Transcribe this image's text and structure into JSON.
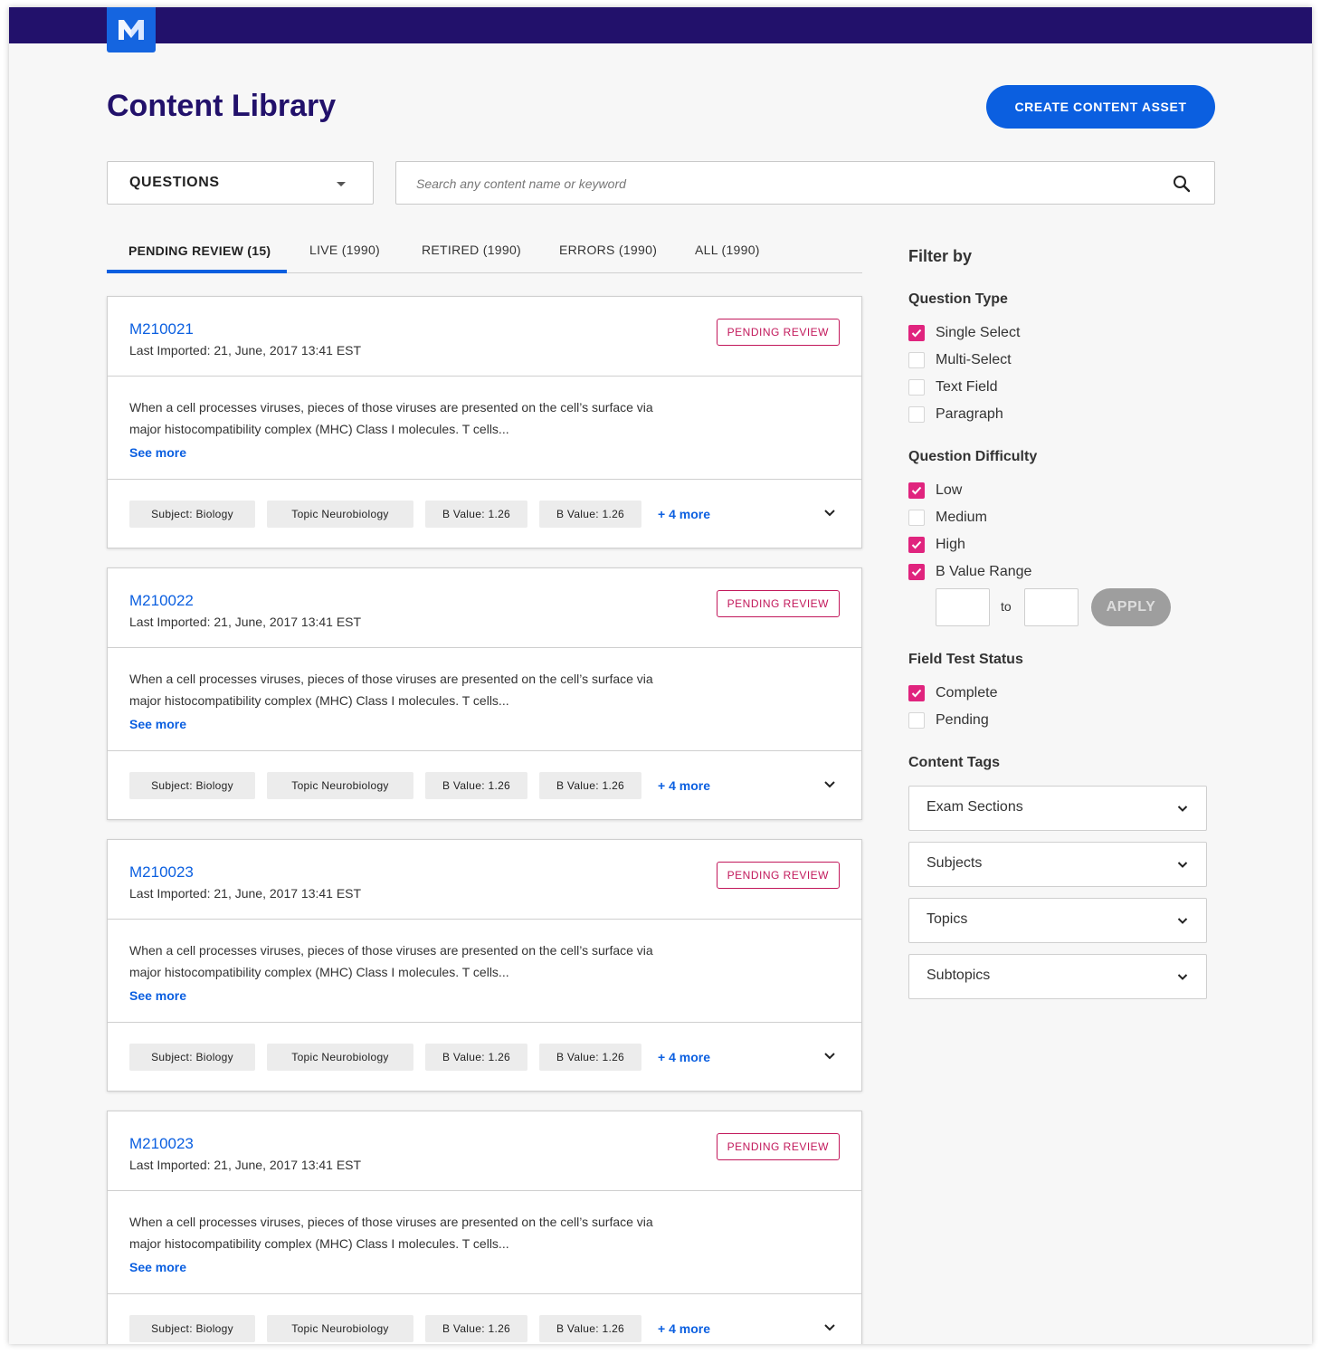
{
  "app": {
    "logo_letter": "M",
    "page_title": "Content Library",
    "create_button": "CREATE CONTENT ASSET"
  },
  "toolbar": {
    "type_select_value": "QUESTIONS",
    "search_placeholder": "Search any content name or keyword"
  },
  "tabs": [
    {
      "label": "PENDING REVIEW (15)",
      "active": true
    },
    {
      "label": "LIVE (1990)",
      "active": false
    },
    {
      "label": "RETIRED (1990)",
      "active": false
    },
    {
      "label": "ERRORS (1990)",
      "active": false
    },
    {
      "label": "ALL (1990)",
      "active": false
    }
  ],
  "cards": [
    {
      "id": "M210021",
      "imported": "Last Imported: 21, June, 2017 13:41 EST",
      "badge": "PENDING REVIEW",
      "desc_line1": "When a cell processes viruses, pieces of those viruses are presented on the cell’s surface via",
      "desc_line2": "major histocompatibility complex (MHC) Class I molecules. T cells...",
      "see_more": "See more",
      "tags": [
        "Subject: Biology",
        "Topic Neurobiology",
        "B Value: 1.26",
        "B Value: 1.26"
      ],
      "more": "+ 4 more"
    },
    {
      "id": "M210022",
      "imported": "Last Imported: 21, June, 2017 13:41 EST",
      "badge": "PENDING REVIEW",
      "desc_line1": "When a cell processes viruses, pieces of those viruses are presented on the cell’s surface via",
      "desc_line2": "major histocompatibility complex (MHC) Class I molecules. T cells...",
      "see_more": "See more",
      "tags": [
        "Subject: Biology",
        "Topic Neurobiology",
        "B Value: 1.26",
        "B Value: 1.26"
      ],
      "more": "+ 4 more"
    },
    {
      "id": "M210023",
      "imported": "Last Imported: 21, June, 2017 13:41 EST",
      "badge": "PENDING REVIEW",
      "desc_line1": "When a cell processes viruses, pieces of those viruses are presented on the cell’s surface via",
      "desc_line2": "major histocompatibility complex (MHC) Class I molecules. T cells...",
      "see_more": "See more",
      "tags": [
        "Subject: Biology",
        "Topic Neurobiology",
        "B Value: 1.26",
        "B Value: 1.26"
      ],
      "more": "+ 4 more"
    },
    {
      "id": "M210023",
      "imported": "Last Imported: 21, June, 2017 13:41 EST",
      "badge": "PENDING REVIEW",
      "desc_line1": "When a cell processes viruses, pieces of those viruses are presented on the cell’s surface via",
      "desc_line2": "major histocompatibility complex (MHC) Class I molecules. T cells...",
      "see_more": "See more",
      "tags": [
        "Subject: Biology",
        "Topic Neurobiology",
        "B Value: 1.26",
        "B Value: 1.26"
      ],
      "more": "+ 4 more"
    }
  ],
  "filters": {
    "title": "Filter by",
    "question_type": {
      "label": "Question Type",
      "options": [
        {
          "label": "Single Select",
          "checked": true
        },
        {
          "label": "Multi-Select",
          "checked": false
        },
        {
          "label": "Text Field",
          "checked": false
        },
        {
          "label": "Paragraph",
          "checked": false
        }
      ]
    },
    "difficulty": {
      "label": "Question Difficulty",
      "options": [
        {
          "label": "Low",
          "checked": true
        },
        {
          "label": "Medium",
          "checked": false
        },
        {
          "label": "High",
          "checked": true
        },
        {
          "label": "B Value Range",
          "checked": true
        }
      ],
      "range_to": "to",
      "apply": "APPLY"
    },
    "field_test": {
      "label": "Field Test Status",
      "options": [
        {
          "label": "Complete",
          "checked": true
        },
        {
          "label": "Pending",
          "checked": false
        }
      ]
    },
    "content_tags": {
      "label": "Content Tags",
      "dropdowns": [
        "Exam Sections",
        "Subjects",
        "Topics",
        "Subtopics"
      ]
    }
  },
  "colors": {
    "topbar": "#22116b",
    "accent": "#0b5fe0",
    "badge": "#c2185b",
    "checkbox_on": "#e0247e"
  }
}
